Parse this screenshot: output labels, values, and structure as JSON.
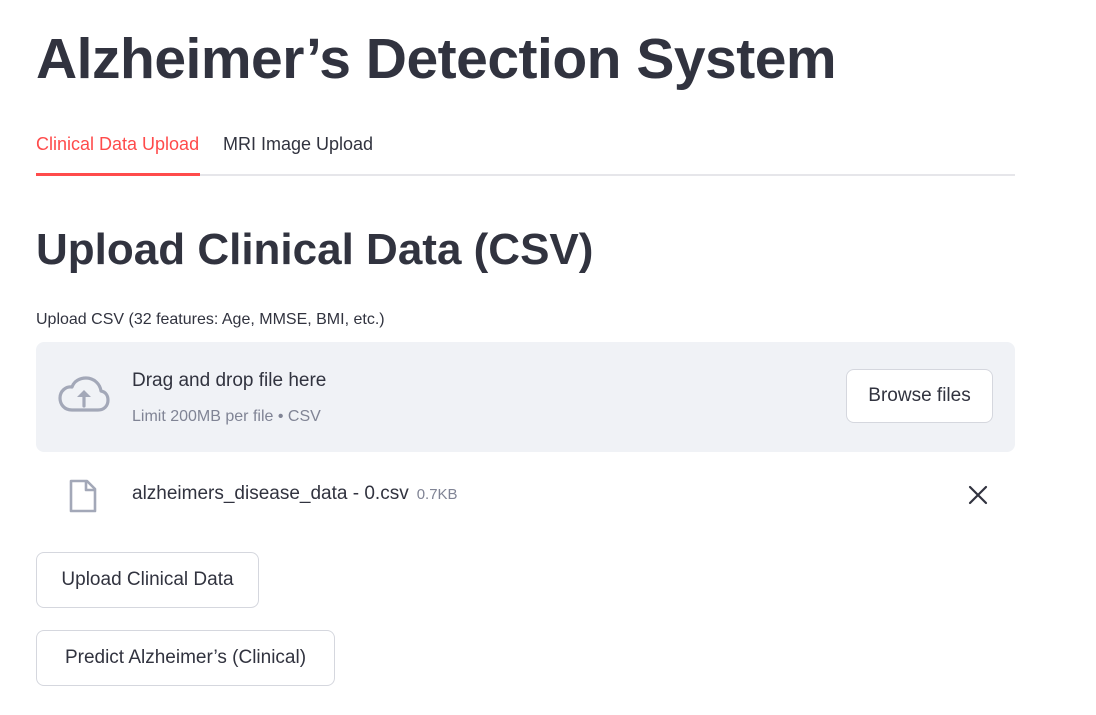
{
  "app": {
    "title": "Alzheimer’s Detection System"
  },
  "tabs": [
    {
      "label": "Clinical Data Upload",
      "active": true
    },
    {
      "label": "MRI Image Upload",
      "active": false
    }
  ],
  "section": {
    "heading": "Upload Clinical Data (CSV)"
  },
  "uploader": {
    "label": "Upload CSV (32 features: Age, MMSE, BMI, etc.)",
    "drop_text": "Drag and drop file here",
    "limit_text": "Limit 200MB per file • CSV",
    "browse_label": "Browse files",
    "icon": "cloud-upload-icon"
  },
  "uploaded_file": {
    "name": "alzheimers_disease_data - 0.csv",
    "size": "0.7KB",
    "icon": "file-icon",
    "remove_icon": "close-icon"
  },
  "actions": {
    "upload_label": "Upload Clinical Data",
    "predict_label": "Predict Alzheimer’s (Clinical)"
  },
  "colors": {
    "accent": "#ff4b4b",
    "text": "#31333f",
    "muted": "#808495",
    "dropzone_bg": "#f0f2f6",
    "icon": "#a3a8b8"
  }
}
